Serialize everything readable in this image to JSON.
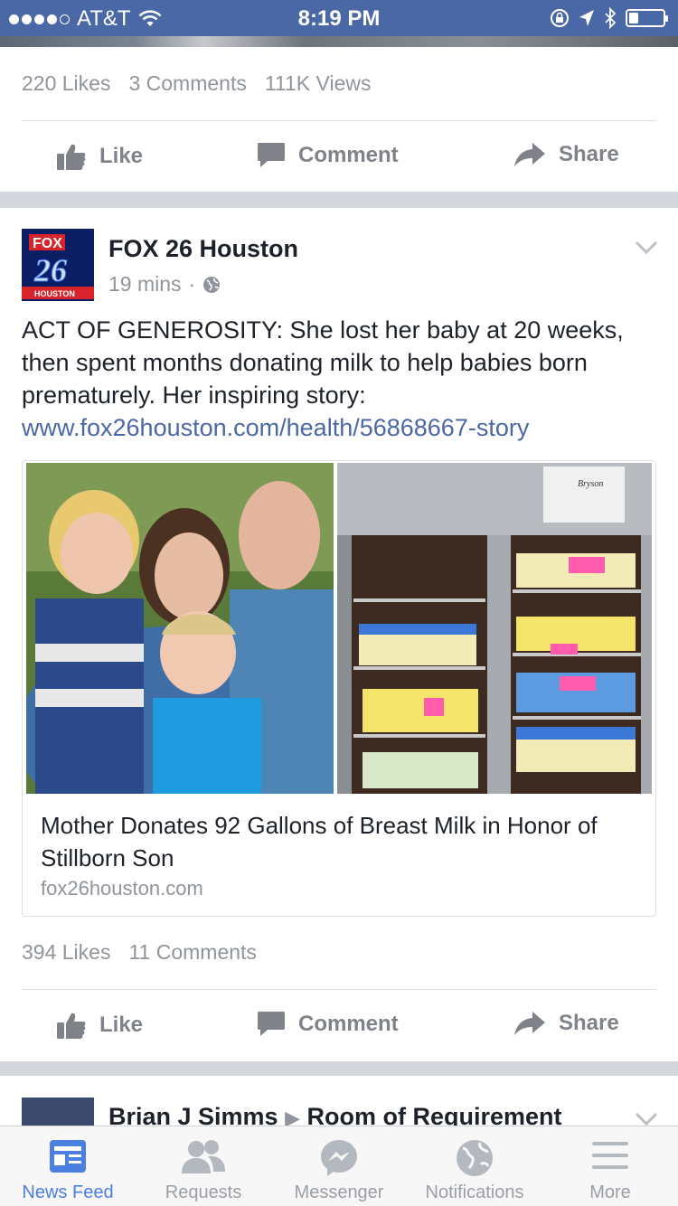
{
  "status_bar": {
    "carrier": "AT&T",
    "time": "8:19 PM",
    "signal_bars": 4,
    "battery_level": 0.25
  },
  "previous_post": {
    "likes": "220 Likes",
    "comments": "3 Comments",
    "views": "111K Views",
    "actions": {
      "like": "Like",
      "comment": "Comment",
      "share": "Share"
    }
  },
  "post": {
    "page_name": "FOX 26 Houston",
    "time": "19 mins",
    "separator": "·",
    "avatar": {
      "brand": "FOX",
      "number": "26",
      "city": "HOUSTON"
    },
    "text": "ACT OF GENEROSITY: She lost her baby at 20 weeks, then spent months donating milk to help babies born prematurely. Her inspiring story:",
    "link_url": "www.fox26houston.com/health/56868667-story",
    "link": {
      "title": "Mother Donates 92 Gallons of Breast Milk in Honor of Stillborn Son",
      "domain": "fox26houston.com",
      "image_note": "Bryson"
    },
    "likes": "394 Likes",
    "comments": "11 Comments",
    "actions": {
      "like": "Like",
      "comment": "Comment",
      "share": "Share"
    }
  },
  "next_post": {
    "author": "Brian J Simms",
    "arrow": "▶",
    "group": "Room of Requirement"
  },
  "tab_bar": {
    "tabs": [
      {
        "label": "News Feed",
        "icon": "news-feed-icon",
        "active": true
      },
      {
        "label": "Requests",
        "icon": "friends-icon",
        "active": false
      },
      {
        "label": "Messenger",
        "icon": "messenger-icon",
        "active": false
      },
      {
        "label": "Notifications",
        "icon": "globe-icon",
        "active": false
      },
      {
        "label": "More",
        "icon": "menu-icon",
        "active": false
      }
    ]
  },
  "colors": {
    "brand_blue": "#4a67a6",
    "link_blue": "#4b67a6",
    "active_tab": "#4b7fe0",
    "muted_text": "#90949c"
  }
}
